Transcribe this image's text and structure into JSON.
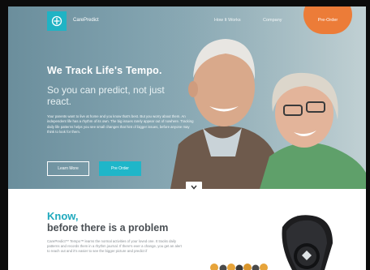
{
  "nav": {
    "logo_text": "CarePredict",
    "links": [
      "How It Works",
      "Company"
    ],
    "preorder_label": "Pre-Order"
  },
  "hero": {
    "headline": "We Track Life's Tempo.",
    "subheadline": "So you can predict, not just react.",
    "body": "Your parents want to live at home and you know that's best. But you worry about them. An independent life has a rhythm of its own. The big issues rarely appear out of nowhere. Tracking daily life patterns helps you see small changes that hint of bigger issues, before anyone may think to look for them.",
    "learn_more": "Learn More",
    "pre_order": "Pre Order"
  },
  "lower": {
    "title": "Know,",
    "subtitle": "before there is a problem",
    "body": "CarePredict™ Tempo™ learns the normal activities of your loved one. It tracks daily patterns and records them in a rhythm journal. If there's ever a change, you get an alert to reach out and it's easier to see the bigger picture and predict if"
  },
  "icons": {
    "logo": "carepredict-logo-icon",
    "scroll": "chevron-down-icon"
  },
  "colors": {
    "accent": "#1fb6c9",
    "preorder": "#ec7c38",
    "hero_bg": "#7c9eab"
  }
}
